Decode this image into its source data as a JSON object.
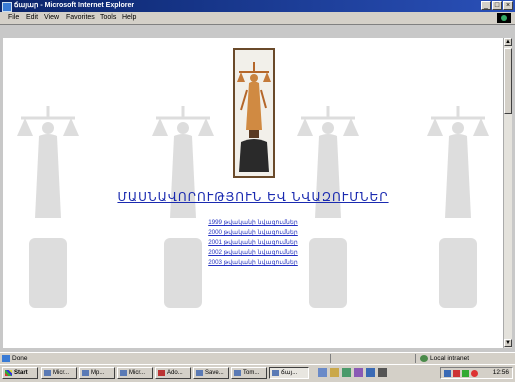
{
  "window": {
    "title": "ճայար - Microsoft Internet Explorer",
    "buttons": [
      "_",
      "□",
      "×"
    ]
  },
  "menubar": {
    "items": [
      "File",
      "Edit",
      "View",
      "Favorites",
      "Tools",
      "Help"
    ]
  },
  "page": {
    "heading": "ՄԱՍՆԱՎՈՐՈՒԹՅՈՒՆ ԵՎ ՆՎԱԶՈՒՄՆԵՐ",
    "links": [
      "1999 թվականի նվազումներ",
      "2000 թվականի նվազումներ",
      "2001 թվականի նվազումներ",
      "2002 թվականի նվազումներ",
      "2003 թվականի նվազումներ"
    ]
  },
  "statusbar": {
    "left": "Done",
    "zone": "Local intranet"
  },
  "taskbar": {
    "start": "Start",
    "buttons": [
      "Micr...",
      "Mp...",
      "Micr...",
      "Ado...",
      "Save...",
      "Tom...",
      "ճայ..."
    ],
    "clock": "12:56"
  },
  "icons": {
    "app": "ie-icon",
    "throbber": "windows-logo-icon",
    "zone": "intranet-icon"
  },
  "colors": {
    "titlebar": "#0a246a",
    "link": "#2230c0",
    "heading": "#1a2ab0",
    "chrome": "#d4d0c8"
  }
}
